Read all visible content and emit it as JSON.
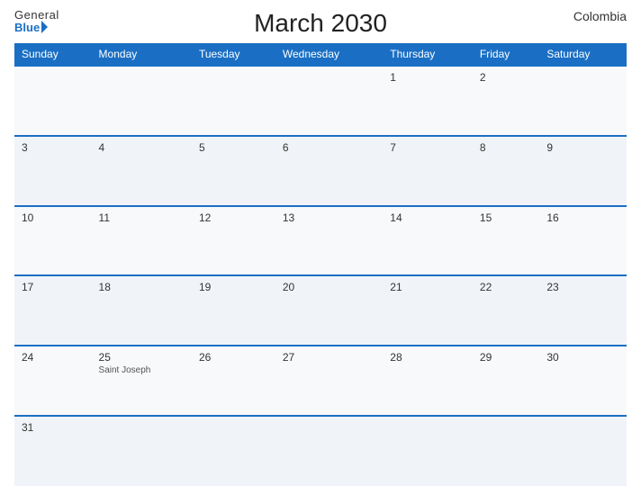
{
  "header": {
    "title": "March 2030",
    "country": "Colombia",
    "logo_general": "General",
    "logo_blue": "Blue"
  },
  "calendar": {
    "weekdays": [
      "Sunday",
      "Monday",
      "Tuesday",
      "Wednesday",
      "Thursday",
      "Friday",
      "Saturday"
    ],
    "rows": [
      [
        {
          "day": "",
          "event": ""
        },
        {
          "day": "",
          "event": ""
        },
        {
          "day": "",
          "event": ""
        },
        {
          "day": "",
          "event": ""
        },
        {
          "day": "1",
          "event": ""
        },
        {
          "day": "2",
          "event": ""
        },
        {
          "day": "",
          "event": ""
        }
      ],
      [
        {
          "day": "3",
          "event": ""
        },
        {
          "day": "4",
          "event": ""
        },
        {
          "day": "5",
          "event": ""
        },
        {
          "day": "6",
          "event": ""
        },
        {
          "day": "7",
          "event": ""
        },
        {
          "day": "8",
          "event": ""
        },
        {
          "day": "9",
          "event": ""
        }
      ],
      [
        {
          "day": "10",
          "event": ""
        },
        {
          "day": "11",
          "event": ""
        },
        {
          "day": "12",
          "event": ""
        },
        {
          "day": "13",
          "event": ""
        },
        {
          "day": "14",
          "event": ""
        },
        {
          "day": "15",
          "event": ""
        },
        {
          "day": "16",
          "event": ""
        }
      ],
      [
        {
          "day": "17",
          "event": ""
        },
        {
          "day": "18",
          "event": ""
        },
        {
          "day": "19",
          "event": ""
        },
        {
          "day": "20",
          "event": ""
        },
        {
          "day": "21",
          "event": ""
        },
        {
          "day": "22",
          "event": ""
        },
        {
          "day": "23",
          "event": ""
        }
      ],
      [
        {
          "day": "24",
          "event": ""
        },
        {
          "day": "25",
          "event": "Saint Joseph"
        },
        {
          "day": "26",
          "event": ""
        },
        {
          "day": "27",
          "event": ""
        },
        {
          "day": "28",
          "event": ""
        },
        {
          "day": "29",
          "event": ""
        },
        {
          "day": "30",
          "event": ""
        }
      ],
      [
        {
          "day": "31",
          "event": ""
        },
        {
          "day": "",
          "event": ""
        },
        {
          "day": "",
          "event": ""
        },
        {
          "day": "",
          "event": ""
        },
        {
          "day": "",
          "event": ""
        },
        {
          "day": "",
          "event": ""
        },
        {
          "day": "",
          "event": ""
        }
      ]
    ]
  }
}
